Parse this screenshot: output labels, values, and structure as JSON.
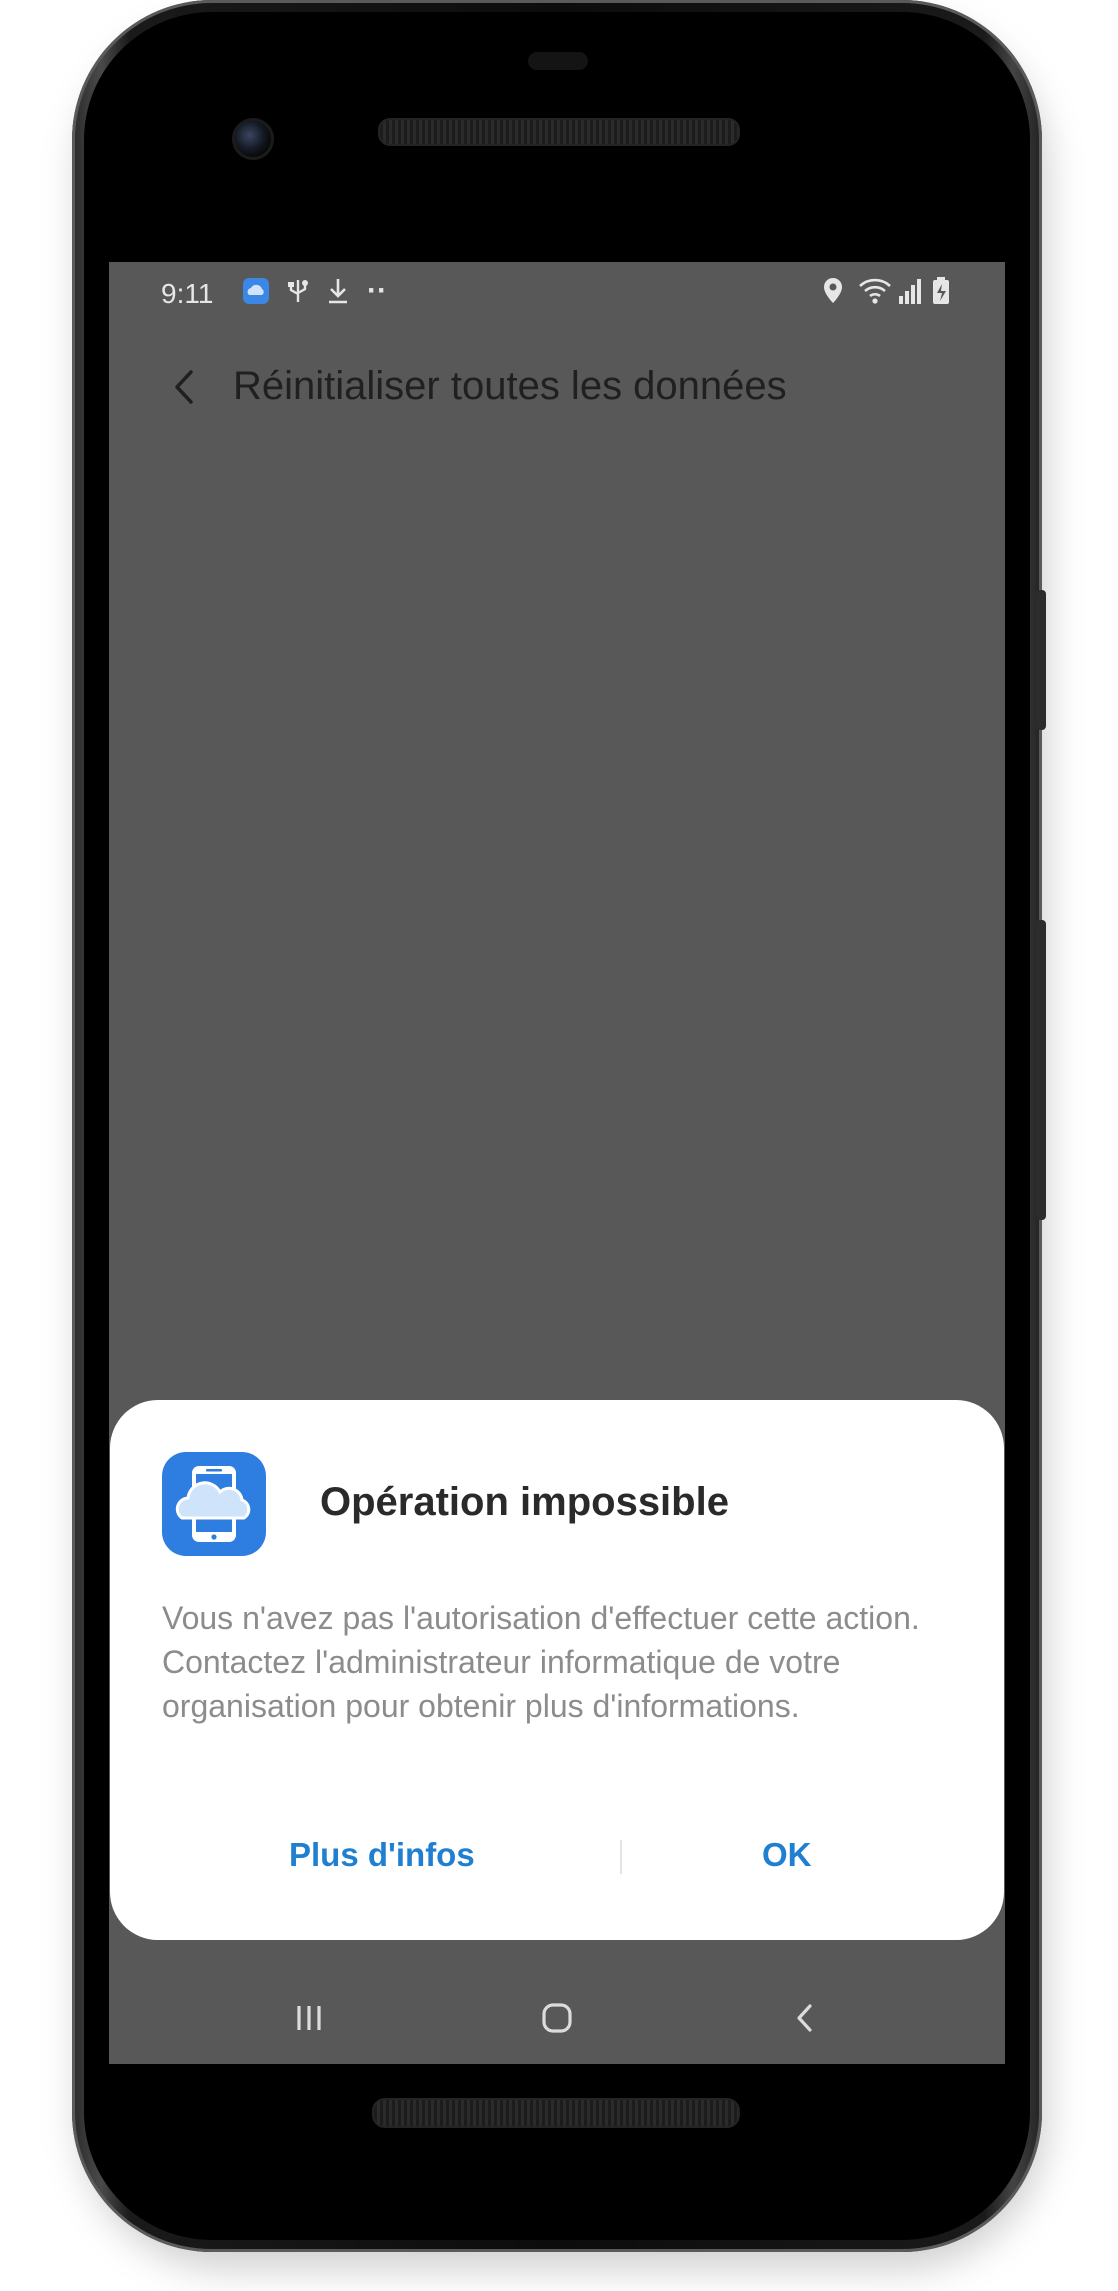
{
  "status_bar": {
    "time": "9:11",
    "left_icons": [
      "app-notification-icon",
      "usb-icon",
      "download-icon",
      "more-dots-icon"
    ],
    "right_icons": [
      "location-icon",
      "wifi-icon",
      "signal-icon",
      "battery-icon"
    ],
    "more_dots": "··"
  },
  "app_bar": {
    "back_icon": "chevron-left-icon",
    "title": "Réinitialiser toutes les données"
  },
  "dialog": {
    "icon": "cloud-device-icon",
    "title": "Opération impossible",
    "message": "Vous n'avez pas l'autorisation d'effectuer cette action. Contactez l'administrateur informatique de votre organisation pour obtenir plus d'informations.",
    "buttons": {
      "more_info": "Plus d'infos",
      "ok": "OK"
    }
  },
  "nav_bar": {
    "icons": [
      "recent-apps-icon",
      "home-icon",
      "back-icon"
    ]
  },
  "colors": {
    "screen_dim": "#585858",
    "dialog_bg": "#ffffff",
    "accent": "#1f7fd1",
    "icon_bg": "#2e7de0",
    "message_text": "#8c8c8c"
  }
}
